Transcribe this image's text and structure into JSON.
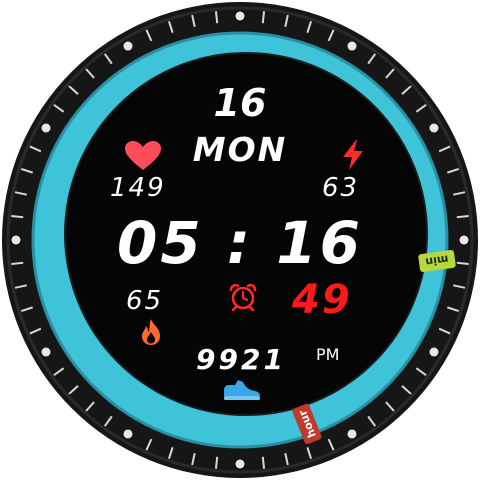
{
  "watch_face": {
    "date": "16",
    "weekday": "MON",
    "heart_rate": "149",
    "battery": "63",
    "time": "05 : 16",
    "calories": "65",
    "seconds": "49",
    "steps": "9921",
    "ampm": "PM",
    "hand_labels": {
      "minute": "min",
      "hour": "hour"
    }
  },
  "icons": {
    "heart": "heart-icon",
    "battery": "lightning-icon",
    "alarm": "alarm-clock-icon",
    "calories": "flame-icon",
    "steps": "sneaker-icon"
  },
  "colors": {
    "ring": "#3ec3d9",
    "bezel": "#1a1a1a",
    "dial": "#050505",
    "seconds": "#ff1a1a",
    "heart": "#ff4d5a",
    "battery": "#ff2a2a",
    "calories": "#ff6a2a",
    "steps": "#3aa8e8",
    "minute_hand": "#b6d83a",
    "hour_hand": "#c0392b"
  }
}
